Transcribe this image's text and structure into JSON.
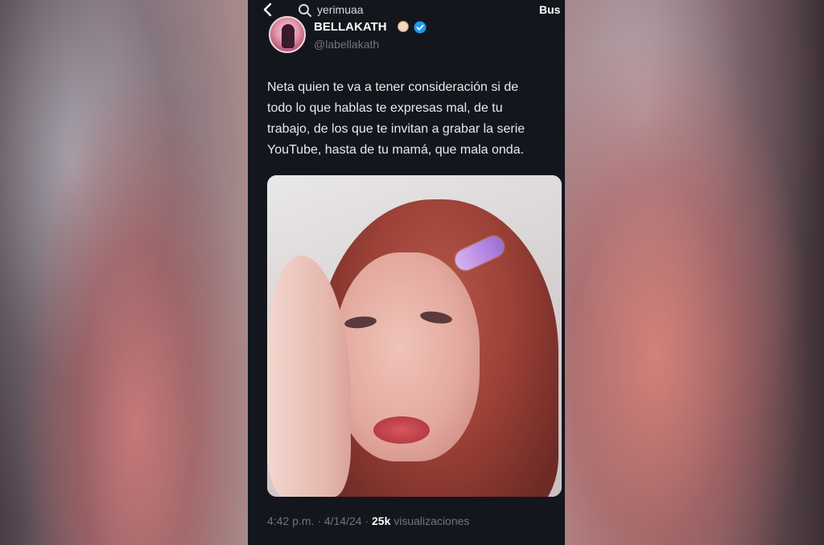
{
  "search": {
    "query": "yerimuaa",
    "action_label": "Bus"
  },
  "tweet": {
    "display_name": "BELLAKATH",
    "handle": "@labellakath",
    "text": "Neta quien te va a tener consideración si de\ntodo lo que hablas te expresas mal, de tu\ntrabajo, de los que te invitan a grabar la serie\nYouTube, hasta de tu mamá, que mala onda.",
    "time": "4:42 p.m.",
    "separator": "·",
    "date": "4/14/24",
    "views_count": "25k",
    "views_label": "visualizaciones"
  },
  "colors": {
    "panel_bg": "#14161d",
    "text_primary": "#e7e9ea",
    "text_secondary": "#71767b",
    "verified": "#1d9bf0"
  },
  "icons": {
    "back": "back-arrow-icon",
    "search": "search-icon",
    "verified": "verified-badge-icon"
  }
}
